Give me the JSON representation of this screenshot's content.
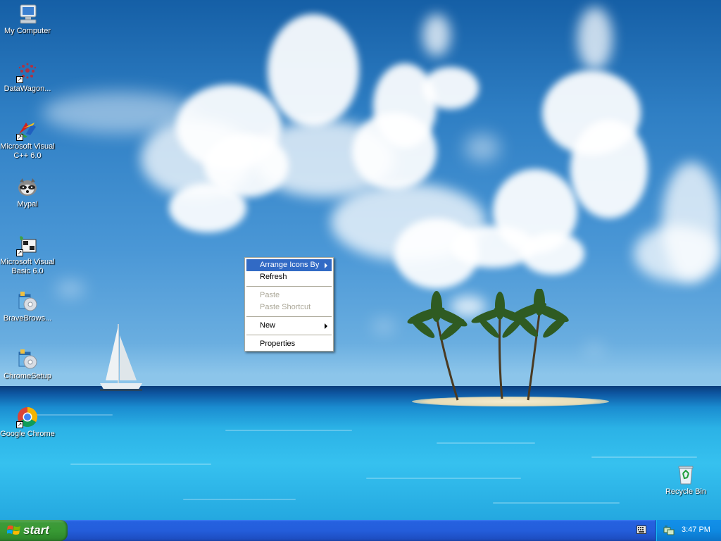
{
  "desktop": {
    "icons": [
      {
        "label": "My Computer",
        "icon": "my-computer-icon"
      },
      {
        "label": "DataWagon...",
        "icon": "datawagon-icon"
      },
      {
        "label": "Microsoft Visual\nC++ 6.0",
        "icon": "visual-cpp-icon"
      },
      {
        "label": "Mypal",
        "icon": "mypal-icon"
      },
      {
        "label": "Microsoft Visual\nBasic 6.0",
        "icon": "visual-basic-icon"
      },
      {
        "label": "BraveBrows...",
        "icon": "installer-icon"
      },
      {
        "label": "ChromeSetup",
        "icon": "installer-icon"
      },
      {
        "label": "Google Chrome",
        "icon": "chrome-icon"
      },
      {
        "label": "Recycle Bin",
        "icon": "recycle-bin-icon"
      }
    ]
  },
  "context_menu": {
    "items": [
      {
        "label": "Arrange Icons By",
        "submenu": true,
        "selected": true,
        "enabled": true
      },
      {
        "label": "Refresh",
        "enabled": true
      },
      {
        "label": "Paste",
        "enabled": false
      },
      {
        "label": "Paste Shortcut",
        "enabled": false
      },
      {
        "label": "New",
        "submenu": true,
        "enabled": true
      },
      {
        "label": "Properties",
        "enabled": true
      }
    ]
  },
  "taskbar": {
    "start_label": "start",
    "clock": "3:47 PM"
  },
  "colors": {
    "taskbar_blue": "#245edb",
    "start_green": "#389a34",
    "menu_highlight": "#316ac5",
    "tray_blue": "#0f8ae2"
  }
}
